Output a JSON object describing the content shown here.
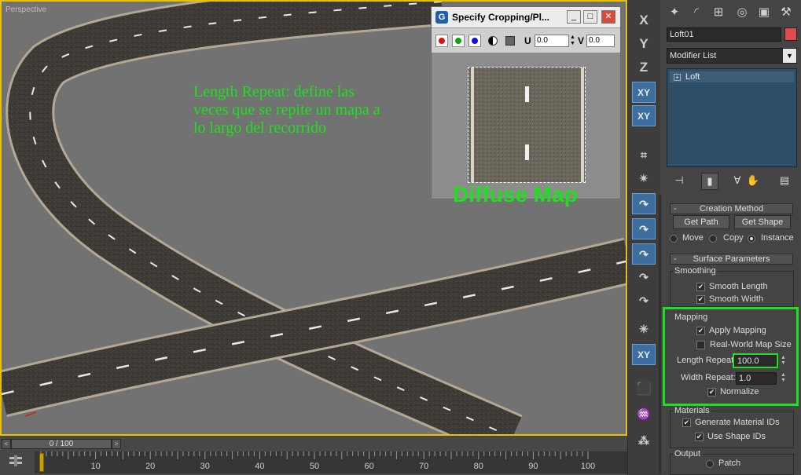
{
  "viewport": {
    "label": "Perspective",
    "annotation": "Length Repeat: define las veces que se repite un mapa a lo largo del recorrido",
    "bg_color": "#727272",
    "border_color": "#e6c200"
  },
  "dialog": {
    "title": "Specify Cropping/Pl...",
    "icon": "app-logo-icon",
    "min_label": "_",
    "max_label": "□",
    "close_label": "✕",
    "channels": [
      {
        "name": "red-channel",
        "color": "#e01010"
      },
      {
        "name": "green-channel",
        "color": "#10a010"
      },
      {
        "name": "blue-channel",
        "color": "#1010e0"
      }
    ],
    "u_label": "U",
    "u_value": "0.0",
    "v_label": "V",
    "v_value": "0.0",
    "overlay_label": "Diffuse Map"
  },
  "timeline": {
    "slider_text": "0 / 100",
    "left_arrow": "<",
    "right_arrow": ">",
    "ticks": [
      "10",
      "20",
      "30",
      "40",
      "50",
      "60",
      "70",
      "80",
      "90",
      "100"
    ]
  },
  "vtools": {
    "x_label": "X",
    "y_label": "Y",
    "z_label": "Z",
    "xy_label": "XY",
    "xy2_label": "XY",
    "xy3_label": "XY"
  },
  "command_panel": {
    "tabs": [
      "create-icon",
      "modify-icon",
      "hierarchy-icon",
      "motion-icon",
      "display-icon",
      "utilities-icon"
    ],
    "object_name": "Loft01",
    "object_color": "#e04b4b",
    "modifier_list": "Modifier List",
    "stack_item": "Loft",
    "creation_method": {
      "header": "Creation Method",
      "mark": "-",
      "get_path": "Get Path",
      "get_shape": "Get Shape",
      "move": "Move",
      "copy": "Copy",
      "instance": "Instance",
      "selected": "instance"
    },
    "surface": {
      "header": "Surface Parameters",
      "mark": "-",
      "smoothing_label": "Smoothing",
      "smooth_length": "Smooth Length",
      "smooth_width": "Smooth Width",
      "mapping_label": "Mapping",
      "apply_mapping": "Apply Mapping",
      "real_world": "Real-World Map Size",
      "length_repeat_label": "Length Repeat:",
      "length_repeat_value": "100.0",
      "width_repeat_label": "Width Repeat:",
      "width_repeat_value": "1.0",
      "normalize": "Normalize",
      "materials_label": "Materials",
      "gen_mat_ids": "Generate Material IDs",
      "use_shape_ids": "Use Shape IDs",
      "output_label": "Output",
      "patch": "Patch"
    },
    "check_mark": "✔",
    "highlight_color": "#1ee01e"
  }
}
